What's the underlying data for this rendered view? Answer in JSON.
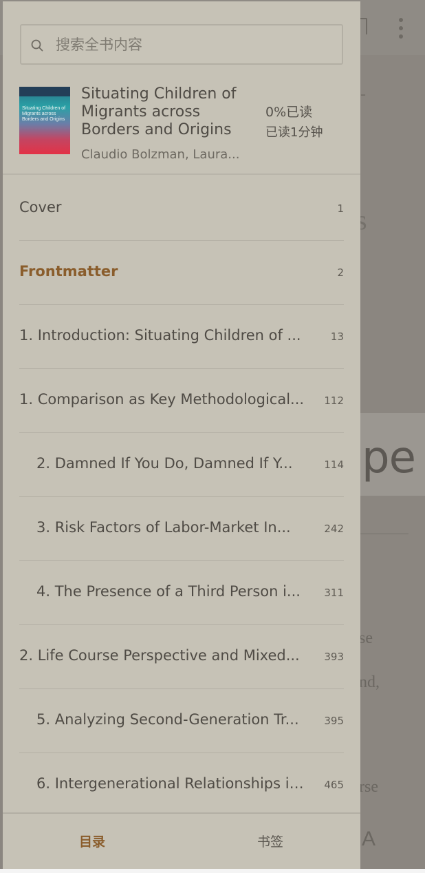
{
  "reader": {
    "fragments": {
      "s": "s",
      "dash": "-",
      "bigword": "pe",
      "line1": "se",
      "line2": "nd,",
      "line3": "rse",
      "font_button": "A"
    }
  },
  "drawer": {
    "search": {
      "placeholder": "搜索全书内容",
      "icon": "search-icon"
    },
    "book": {
      "cover_title": "Situating Children of Migrants across Borders and Origins",
      "title": "Situating Children of Migrants across Borders and Origins",
      "author": "Claudio Bolzman, Laura...",
      "progress": "0%已读",
      "read_time": "已读1分钟"
    },
    "toc": [
      {
        "label": "Cover",
        "page": "1",
        "level": 0,
        "active": false
      },
      {
        "label": "Frontmatter",
        "page": "2",
        "level": 0,
        "active": true
      },
      {
        "label": "1. Introduction: Situating Children of ...",
        "page": "13",
        "level": 0,
        "active": false
      },
      {
        "label": "1. Comparison as Key Methodological...",
        "page": "112",
        "level": 0,
        "active": false
      },
      {
        "label": "2. Damned If You Do, Damned If Y...",
        "page": "114",
        "level": 1,
        "active": false
      },
      {
        "label": "3. Risk Factors of Labor-Market In...",
        "page": "242",
        "level": 1,
        "active": false
      },
      {
        "label": "4. The Presence of a Third Person i...",
        "page": "311",
        "level": 1,
        "active": false
      },
      {
        "label": "2. Life Course Perspective and Mixed...",
        "page": "393",
        "level": 0,
        "active": false
      },
      {
        "label": "5. Analyzing Second-Generation Tr...",
        "page": "395",
        "level": 1,
        "active": false
      },
      {
        "label": "6. Intergenerational Relationships in...",
        "page": "465",
        "level": 1,
        "active": false
      }
    ],
    "tabs": {
      "toc": "目录",
      "bookmarks": "书签"
    }
  },
  "colors": {
    "accent": "#8a5d2c",
    "drawer_bg": "#c6c2b6",
    "overlay_bg": "#8b8680"
  }
}
